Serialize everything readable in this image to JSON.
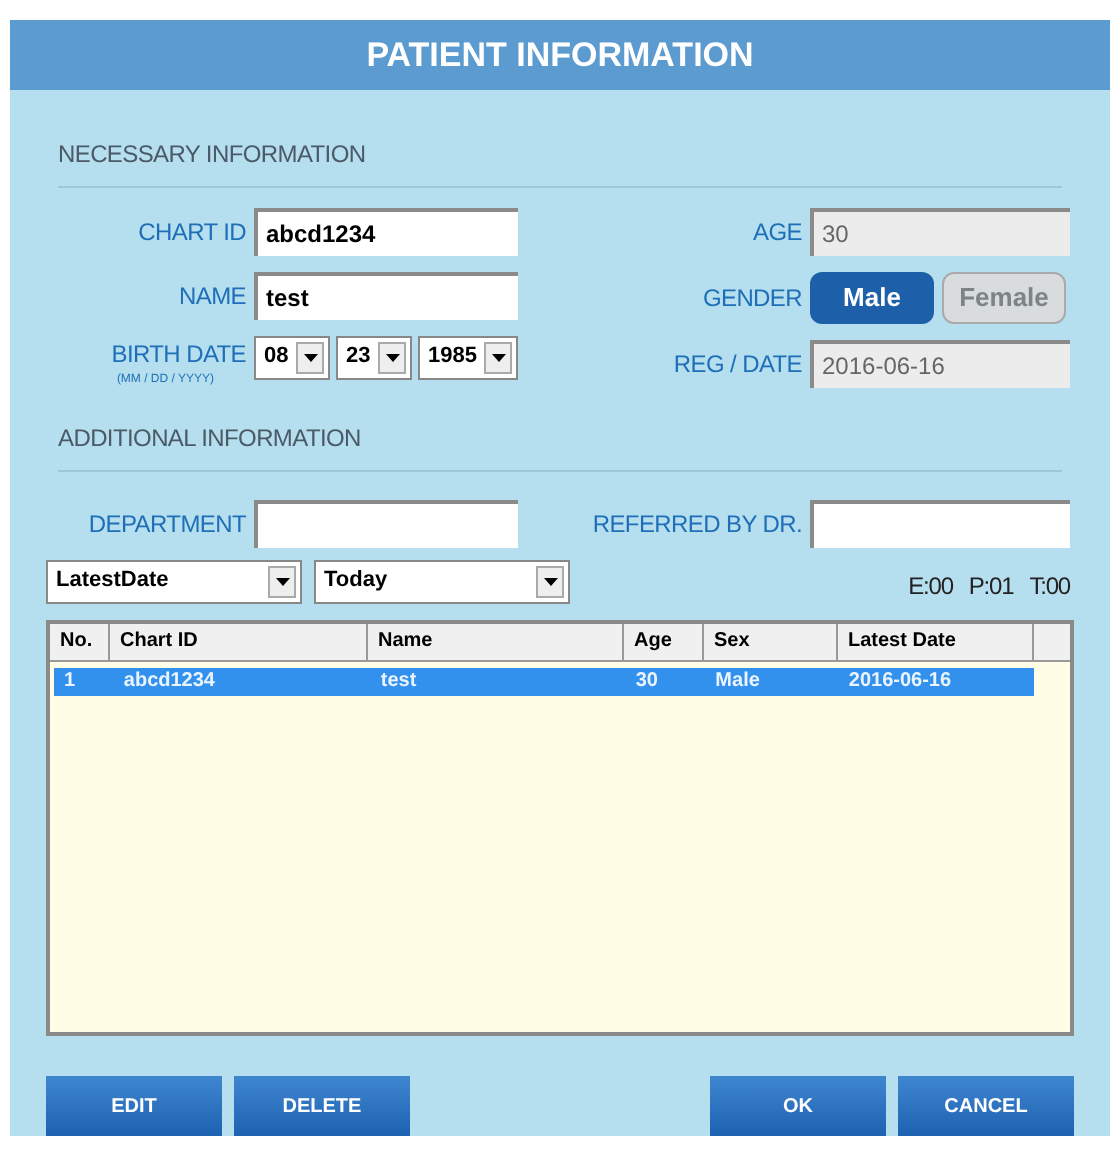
{
  "window": {
    "title": "PATIENT INFORMATION"
  },
  "necessary": {
    "heading": "NECESSARY INFORMATION",
    "chart_id": {
      "label": "CHART ID",
      "value": "abcd1234"
    },
    "name": {
      "label": "NAME",
      "value": "test"
    },
    "birth_date": {
      "label": "BIRTH DATE",
      "hint": "(MM / DD / YYYY)",
      "month": "08",
      "day": "23",
      "year": "1985"
    },
    "age": {
      "label": "AGE",
      "value": "30",
      "disabled": true
    },
    "gender": {
      "label": "GENDER",
      "options": [
        {
          "label": "Male",
          "selected": true
        },
        {
          "label": "Female",
          "selected": false
        }
      ]
    },
    "reg_date": {
      "label": "REG / DATE",
      "value": "2016-06-16",
      "disabled": true
    }
  },
  "additional": {
    "heading": "ADDITIONAL INFORMATION",
    "department": {
      "label": "DEPARTMENT"
    },
    "referred_by": {
      "label": "REFERRED BY DR."
    }
  },
  "filters": [
    {
      "value": "LatestDate"
    },
    {
      "value": "Today"
    }
  ],
  "counts": [
    "E:00",
    "P:01",
    "T:00"
  ],
  "table": {
    "columns": [
      "No.",
      "Chart ID",
      "Name",
      "Age",
      "Sex",
      "Latest Date"
    ],
    "rows": [
      {
        "cells": [
          "1",
          "abcd1234",
          "test",
          "30",
          "Male",
          "2016-06-16"
        ],
        "selected": true
      }
    ]
  },
  "buttons_left": [
    "EDIT",
    "DELETE"
  ],
  "buttons_right": [
    "OK",
    "CANCEL"
  ]
}
